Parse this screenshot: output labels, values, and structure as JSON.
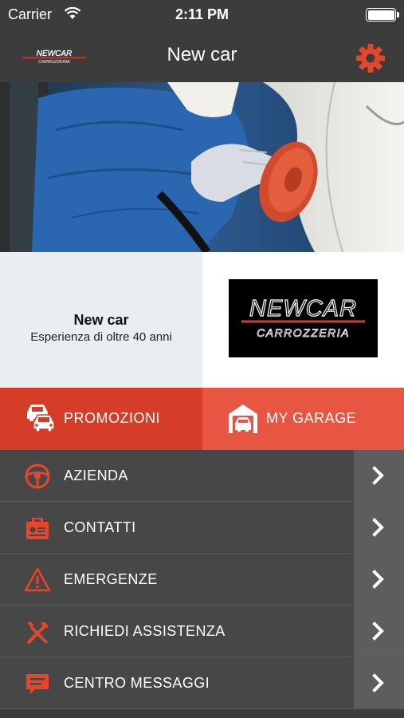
{
  "status_bar": {
    "carrier": "Carrier",
    "time": "2:11 PM",
    "icons": [
      "wifi-icon",
      "battery-icon"
    ]
  },
  "nav_bar": {
    "title": "New car",
    "logo_text": "NEWCAR CARROZZERIA",
    "settings_icon": "gear-icon",
    "accent_color": "#e6462c"
  },
  "info": {
    "title": "New car",
    "subtitle": "Esperienza di oltre 40 anni",
    "brand_line1": "NEWCAR",
    "brand_line2": "CARROZZERIA"
  },
  "tiles": {
    "promo": {
      "label": "PROMOZIONI",
      "icon": "cars-icon",
      "color": "#d63d28"
    },
    "garage": {
      "label": "MY GARAGE",
      "icon": "garage-icon",
      "color": "#e85643"
    }
  },
  "menu": {
    "items": [
      {
        "label": "AZIENDA",
        "icon": "steering-wheel-icon"
      },
      {
        "label": "CONTATTI",
        "icon": "contact-card-icon"
      },
      {
        "label": "EMERGENZE",
        "icon": "warning-icon"
      },
      {
        "label": "RICHIEDI ASSISTENZA",
        "icon": "tools-icon"
      },
      {
        "label": "CENTRO MESSAGGI",
        "icon": "chat-icon"
      }
    ]
  }
}
